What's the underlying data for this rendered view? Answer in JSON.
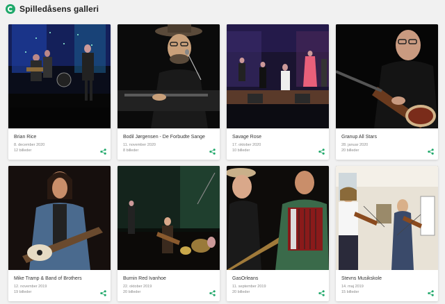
{
  "header": {
    "title": "Spilledåsens galleri",
    "logo_icon": "music-note-icon",
    "accent_color": "#1fa86a"
  },
  "galleries": [
    {
      "name": "Brian Rice",
      "date": "8. december 2020",
      "count": "12 billeder",
      "image": "band-on-stage-blue-lights"
    },
    {
      "name": "Bodil Jørgensen - De Forbudte Sange",
      "date": "11. november 2020",
      "count": "8 billeder",
      "image": "pianist-with-hat-singing"
    },
    {
      "name": "Savage Rose",
      "date": "17. oktober 2020",
      "count": "10 billeder",
      "image": "band-on-stage-wide"
    },
    {
      "name": "Granup All Stars",
      "date": "28. januar 2020",
      "count": "20 billeder",
      "image": "guitarist-closeup"
    },
    {
      "name": "Mike Tramp & Band of Brothers",
      "date": "12. november 2019",
      "count": "19 billeder",
      "image": "singer-with-guitar"
    },
    {
      "name": "Burnin Red Ivanhoe",
      "date": "22. oktober 2019",
      "count": "20 billeder",
      "image": "band-performing"
    },
    {
      "name": "GasOrleans",
      "date": "11. september 2019",
      "count": "20 billeder",
      "image": "accordion-and-guitar"
    },
    {
      "name": "Stevns Musikskole",
      "date": "14. maj 2019",
      "count": "15 billeder",
      "image": "violin-players"
    }
  ],
  "share_icon": "share-icon"
}
